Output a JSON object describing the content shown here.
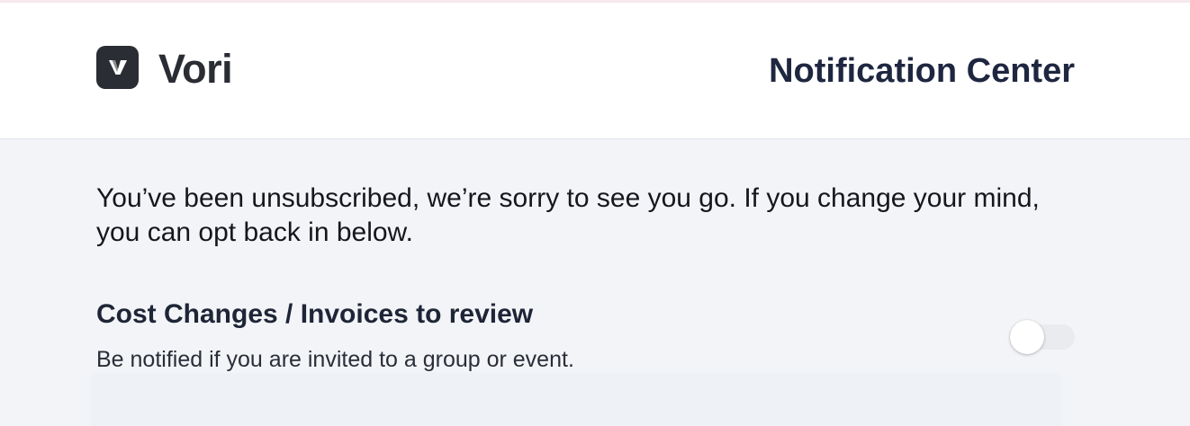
{
  "header": {
    "brand_name": "Vori",
    "logo_icon": "vori-logo-icon",
    "title": "Notification Center"
  },
  "main": {
    "message": "You’ve been unsubscribed, we’re sorry to see you go. If you change your mind, you can opt back in below.",
    "preferences": [
      {
        "title": "Cost Changes / Invoices to review",
        "description": "Be notified if you are invited to a group or event.",
        "enabled": false
      }
    ]
  },
  "colors": {
    "page_background": "#f3f4f8",
    "header_background": "#ffffff",
    "logo": "#2a2d33",
    "heading_text": "#1e2640",
    "toggle_track_off": "#e9ebef"
  }
}
